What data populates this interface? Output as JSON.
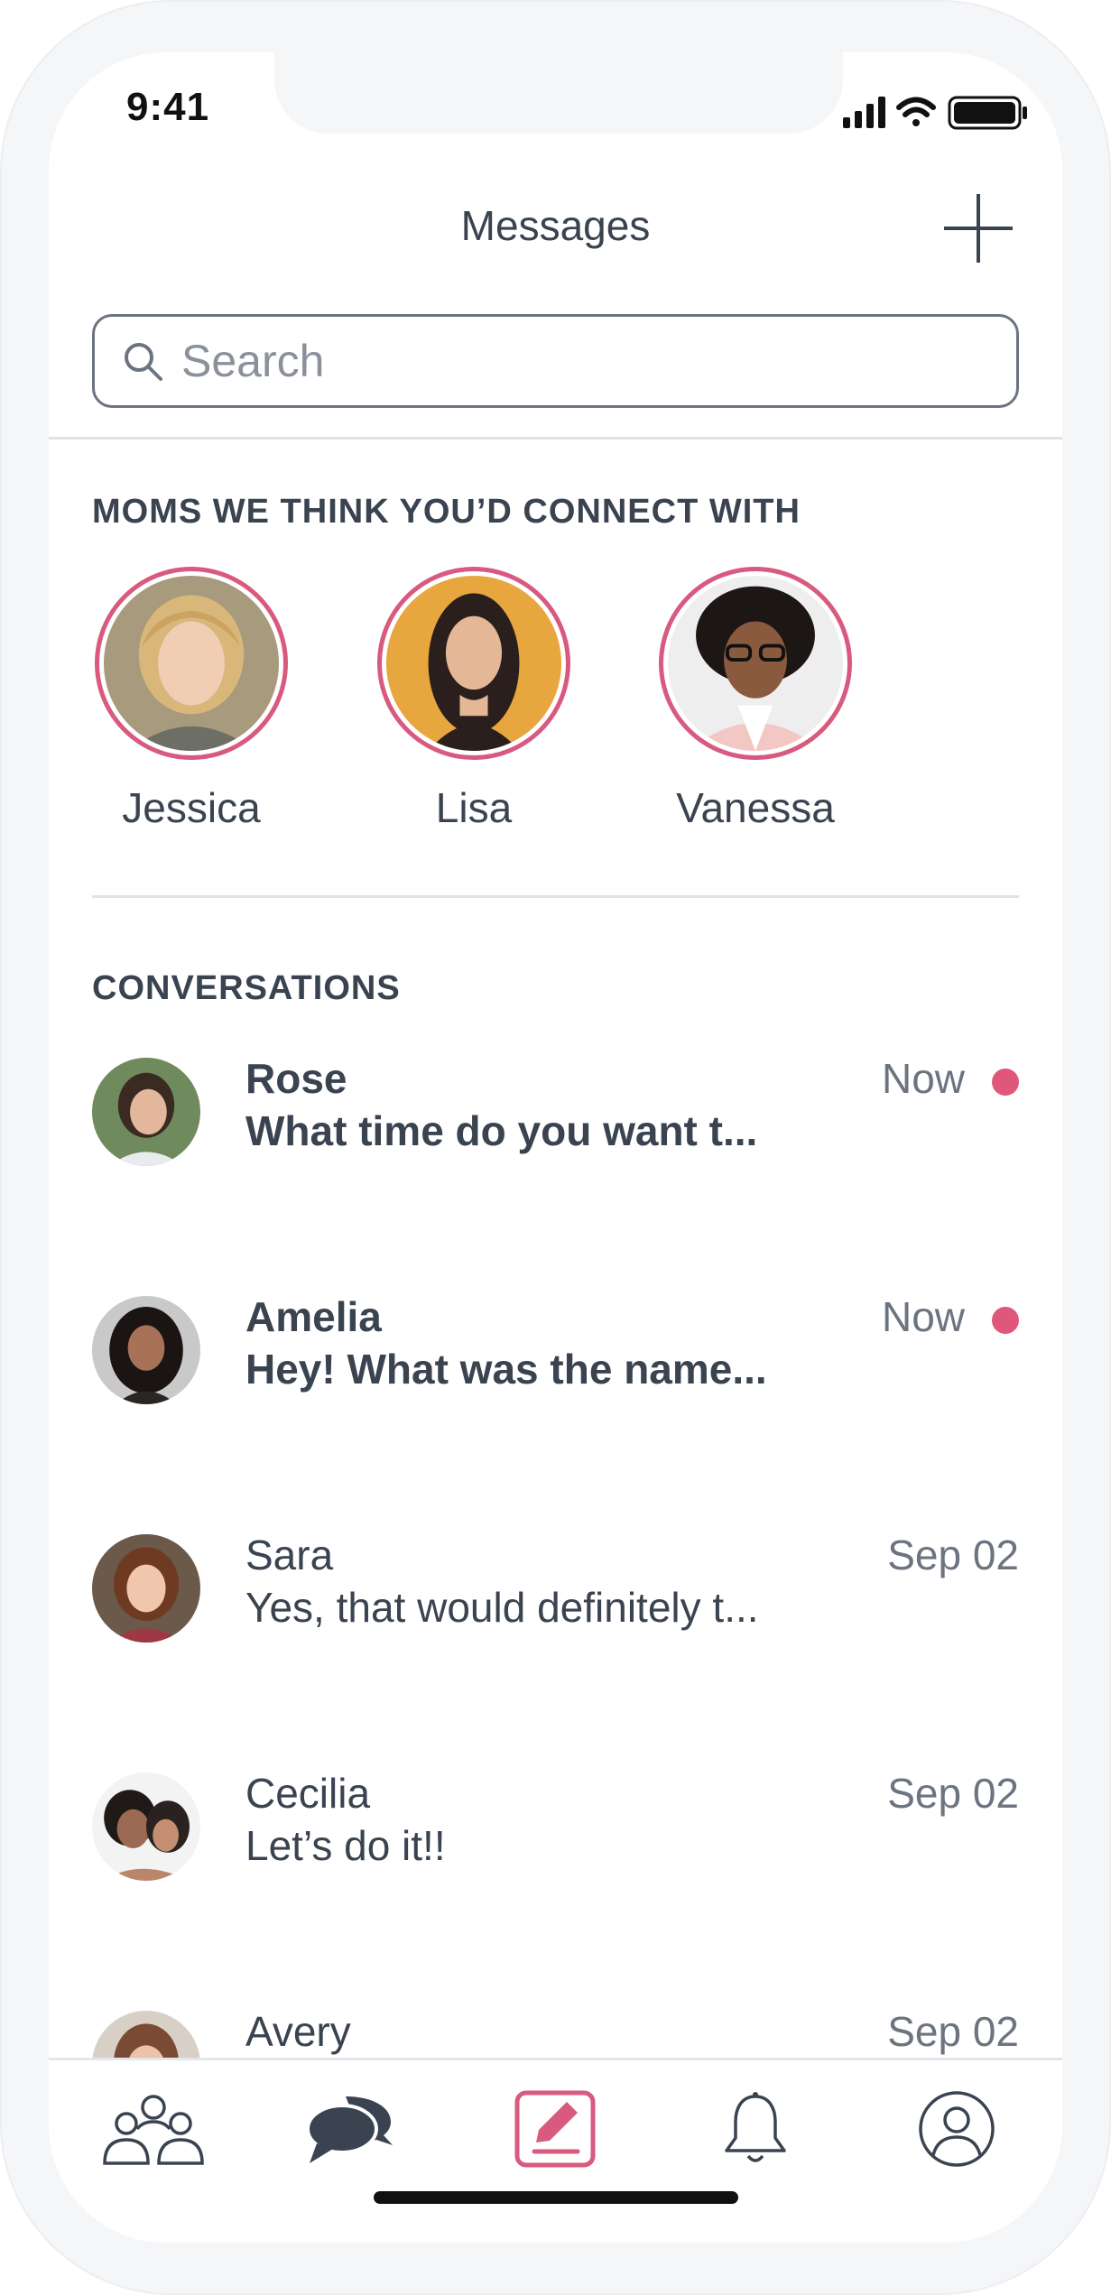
{
  "status_bar": {
    "time": "9:41"
  },
  "header": {
    "title": "Messages"
  },
  "search": {
    "placeholder": "Search"
  },
  "suggestions": {
    "title": "MOMS WE THINK YOU’D CONNECT WITH",
    "people": [
      {
        "name": "Jessica"
      },
      {
        "name": "Lisa"
      },
      {
        "name": "Vanessa"
      }
    ]
  },
  "conversations": {
    "title": "CONVERSATIONS",
    "items": [
      {
        "name": "Rose",
        "preview": "What time do you want t...",
        "time": "Now",
        "unread": true
      },
      {
        "name": "Amelia",
        "preview": "Hey! What was the name...",
        "time": "Now",
        "unread": true
      },
      {
        "name": "Sara",
        "preview": "Yes, that would definitely t...",
        "time": "Sep 02",
        "unread": false
      },
      {
        "name": "Cecilia",
        "preview": "Let’s do it!!",
        "time": "Sep 02",
        "unread": false
      },
      {
        "name": "Avery",
        "preview": "",
        "time": "Sep 02",
        "unread": false
      }
    ]
  },
  "tabbar": {
    "items": [
      {
        "icon": "community-icon"
      },
      {
        "icon": "chat-bubbles-icon"
      },
      {
        "icon": "compose-icon"
      },
      {
        "icon": "bell-icon"
      },
      {
        "icon": "profile-icon"
      }
    ]
  },
  "colors": {
    "accent": "#d85a7f",
    "unread_dot": "#e0577c",
    "text": "#3a4350",
    "muted": "#6c7480"
  }
}
